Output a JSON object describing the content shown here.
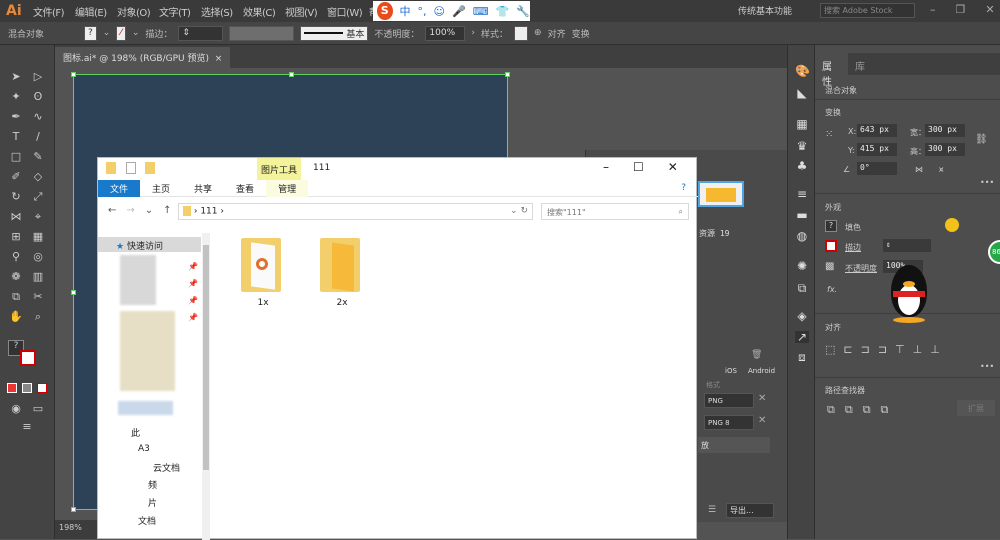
{
  "app": {
    "logo": "Ai",
    "menu": [
      "文件(F)",
      "编辑(E)",
      "对象(O)",
      "文字(T)",
      "选择(S)",
      "效果(C)",
      "视图(V)",
      "窗口(W)",
      "帮"
    ],
    "workspace": "传统基本功能",
    "stock_search_placeholder": "搜索 Adobe Stock"
  },
  "ime": {
    "logo": "S",
    "items": [
      "中",
      "°,",
      "☺",
      "🎤",
      "⌨",
      "👕",
      "🔧"
    ]
  },
  "control_bar": {
    "selection": "混合对象",
    "stroke_label": "描边：",
    "brush": "基本",
    "opacity_label": "不透明度：",
    "opacity": "100%",
    "style_label": "样式：",
    "align": "对齐",
    "transform": "变换"
  },
  "document_tab": {
    "title": "图标.ai* @ 198% (RGB/GPU 预览)"
  },
  "status": {
    "zoom": "198%"
  },
  "properties": {
    "tabs": [
      "属性",
      "库"
    ],
    "object_type": "混合对象",
    "transform_title": "变换",
    "x_label": "X:",
    "x": "643 px",
    "y_label": "Y:",
    "y": "415 px",
    "w_label": "宽：",
    "w": "300 px",
    "h_label": "高：",
    "h": "300 px",
    "angle": "0°",
    "appearance_title": "外观",
    "fill": "填色",
    "stroke": "描边",
    "opacity_label": "不透明度",
    "opacity": "100%",
    "fx": "fx.",
    "align_title": "对齐",
    "pathfinder_title": "路径查找器",
    "expand": "扩展",
    "more": "•••"
  },
  "export_panel": {
    "asset_label": "资源 19",
    "ios": "iOS",
    "android": "Android",
    "format_header": "格式",
    "formats": [
      "PNG",
      "PNG 8"
    ],
    "scale_row": "放",
    "export_button": "导出..."
  },
  "explorer": {
    "context_tab": "图片工具",
    "title": "111",
    "ribbon": [
      "文件",
      "主页",
      "共享",
      "查看",
      "管理"
    ],
    "path": "111",
    "search_placeholder": "搜索\"111\"",
    "quick_access": "快速访问",
    "nav_items": [
      "此",
      "A3",
      "云文档",
      "频",
      "片",
      "文档"
    ],
    "files": [
      {
        "name": "1x"
      },
      {
        "name": "2x"
      }
    ]
  },
  "badge": {
    "text": "86"
  }
}
